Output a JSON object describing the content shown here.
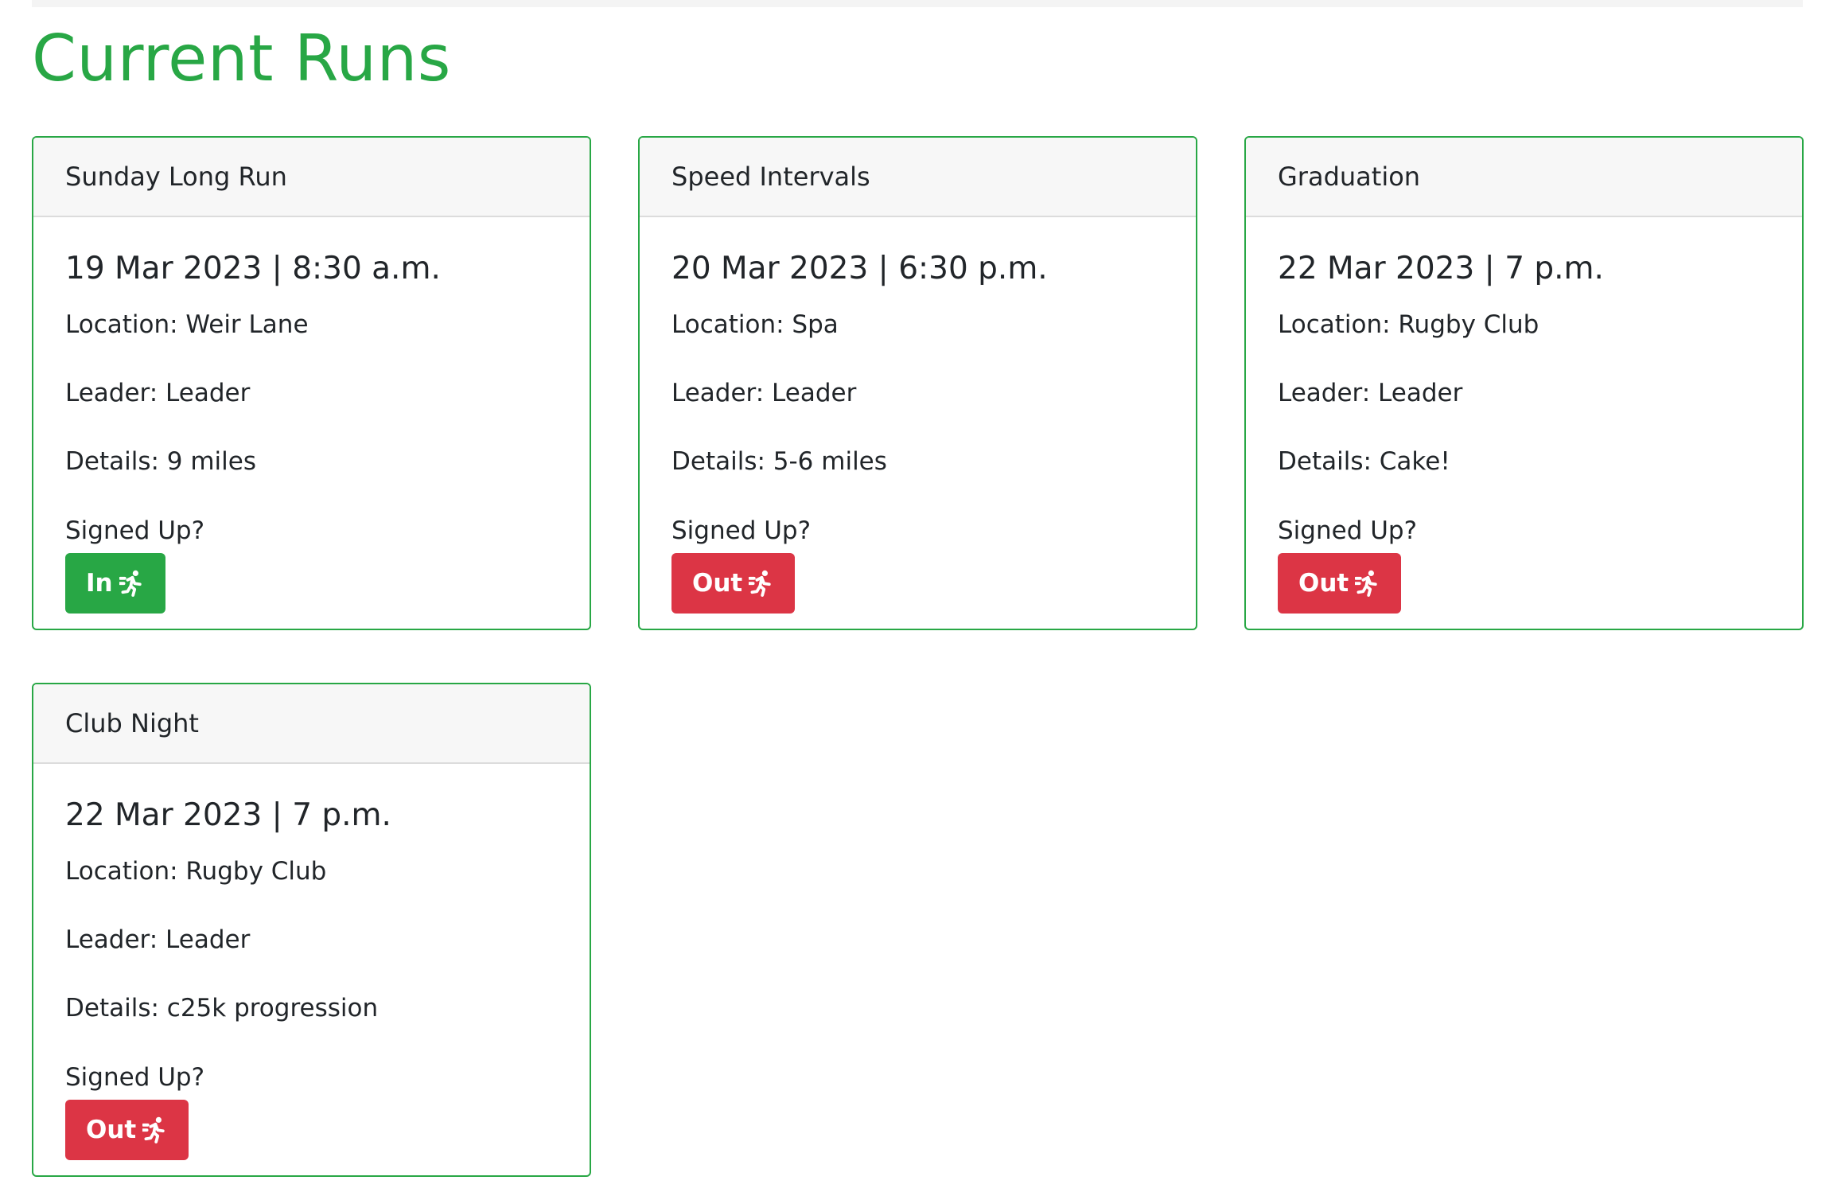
{
  "page": {
    "title": "Current Runs"
  },
  "colors": {
    "accent": "#28a745",
    "in_button": "#28a745",
    "out_button": "#dc3545"
  },
  "runs": [
    {
      "name": "Sunday Long Run",
      "datetime": "19 Mar 2023 | 8:30 a.m.",
      "location": "Location: Weir Lane",
      "leader": "Leader: Leader",
      "details": "Details: 9 miles",
      "signed_label": "Signed Up?",
      "status": "In",
      "status_icon": "running-icon"
    },
    {
      "name": "Speed Intervals",
      "datetime": "20 Mar 2023 | 6:30 p.m.",
      "location": "Location: Spa",
      "leader": "Leader: Leader",
      "details": "Details: 5-6 miles",
      "signed_label": "Signed Up?",
      "status": "Out",
      "status_icon": "running-icon"
    },
    {
      "name": "Graduation",
      "datetime": "22 Mar 2023 | 7 p.m.",
      "location": "Location: Rugby Club",
      "leader": "Leader: Leader",
      "details": "Details: Cake!",
      "signed_label": "Signed Up?",
      "status": "Out",
      "status_icon": "running-icon"
    },
    {
      "name": "Club Night",
      "datetime": "22 Mar 2023 | 7 p.m.",
      "location": "Location: Rugby Club",
      "leader": "Leader: Leader",
      "details": "Details: c25k progression",
      "signed_label": "Signed Up?",
      "status": "Out",
      "status_icon": "running-icon"
    }
  ]
}
